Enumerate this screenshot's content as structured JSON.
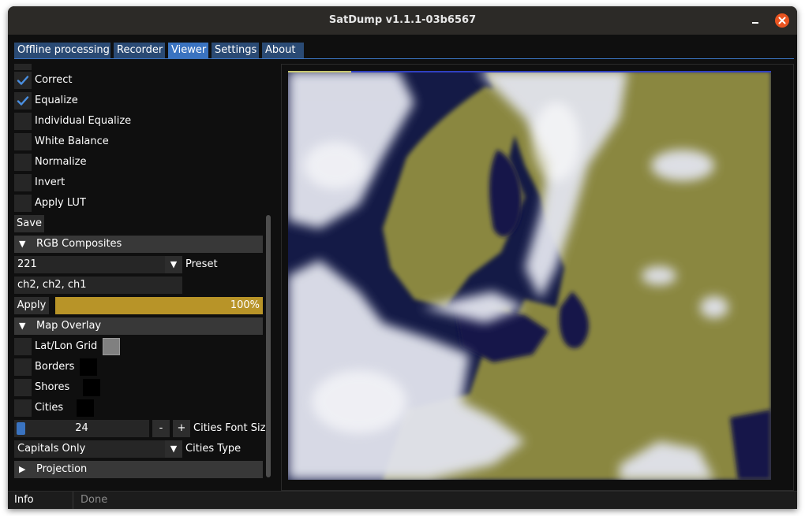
{
  "window": {
    "title": "SatDump v1.1.1-03b6567"
  },
  "tabs": [
    {
      "label": "Offline processing",
      "active": false
    },
    {
      "label": "Recorder",
      "active": false
    },
    {
      "label": "Viewer",
      "active": true
    },
    {
      "label": "Settings",
      "active": false
    },
    {
      "label": "About",
      "active": false
    }
  ],
  "options": [
    {
      "label": "Correct",
      "checked": true
    },
    {
      "label": "Equalize",
      "checked": true
    },
    {
      "label": "Individual Equalize",
      "checked": false
    },
    {
      "label": "White Balance",
      "checked": false
    },
    {
      "label": "Normalize",
      "checked": false
    },
    {
      "label": "Invert",
      "checked": false
    },
    {
      "label": "Apply LUT",
      "checked": false
    }
  ],
  "save_label": "Save",
  "rgb": {
    "header": "RGB Composites",
    "preset_value": "221",
    "preset_label": "Preset",
    "expression": "ch2, ch2, ch1",
    "apply_label": "Apply",
    "progress_text": "100%",
    "progress": 1.0
  },
  "map_overlay": {
    "header": "Map Overlay",
    "items": [
      {
        "label": "Lat/Lon Grid",
        "checked": false,
        "color": "#808080"
      },
      {
        "label": "Borders",
        "checked": false,
        "color": "#000000"
      },
      {
        "label": "Shores",
        "checked": false,
        "color": "#000000"
      },
      {
        "label": "Cities",
        "checked": false,
        "color": "#000000"
      }
    ],
    "font_size_value": "24",
    "font_size_minus": "-",
    "font_size_plus": "+",
    "font_size_label": "Cities Font Size",
    "cities_type_value": "Capitals Only",
    "cities_type_label": "Cities Type"
  },
  "projection": {
    "header": "Projection"
  },
  "status": {
    "left": "Info",
    "right": "Done"
  },
  "colors": {
    "accent": "#3a73c0",
    "tab": "#2a4a74",
    "progress": "#b89428",
    "close": "#e95420"
  }
}
